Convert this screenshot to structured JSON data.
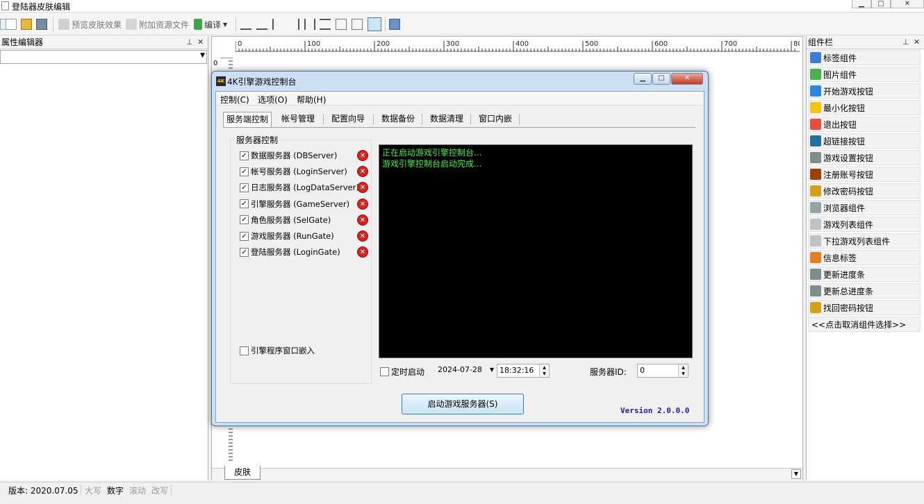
{
  "window": {
    "title": "登陆器皮肤编辑"
  },
  "toolbar": {
    "preview_label": "预览皮肤效果",
    "attach_label": "附加资源文件",
    "compile_label": "编译"
  },
  "left_panel": {
    "title": "属性编辑器"
  },
  "ruler": {
    "h_labels": [
      "0",
      "100",
      "200",
      "300",
      "400",
      "500",
      "600",
      "700",
      "80"
    ],
    "v_label": "0"
  },
  "designer": {
    "tab_label": "皮肤"
  },
  "right_panel": {
    "title": "组件栏",
    "items": [
      {
        "label": "标签组件",
        "color": "#3a7fd5"
      },
      {
        "label": "图片组件",
        "color": "#4caf50"
      },
      {
        "label": "开始游戏按钮",
        "color": "#2e86de"
      },
      {
        "label": "最小化按钮",
        "color": "#f1c40f"
      },
      {
        "label": "退出按钮",
        "color": "#e74c3c"
      },
      {
        "label": "超链接按钮",
        "color": "#2471a3"
      },
      {
        "label": "游戏设置按钮",
        "color": "#7f8c8d"
      },
      {
        "label": "注册账号按钮",
        "color": "#a04000"
      },
      {
        "label": "修改密码按钮",
        "color": "#d4a017"
      },
      {
        "label": "浏览器组件",
        "color": "#95a5a6"
      },
      {
        "label": "游戏列表组件",
        "color": "#bdc3c7"
      },
      {
        "label": "下拉游戏列表组件",
        "color": "#bdc3c7"
      },
      {
        "label": "信息标签",
        "color": "#e67e22"
      },
      {
        "label": "更新进度条",
        "color": "#7f8c8d"
      },
      {
        "label": "更新总进度条",
        "color": "#7f8c8d"
      },
      {
        "label": "找回密码按钮",
        "color": "#d4a017"
      }
    ],
    "cancel_label": "<<点击取消组件选择>>"
  },
  "statusbar": {
    "version": "版本: 2020.07.05",
    "caps": "大写",
    "num": "数字",
    "scroll": "滚动",
    "insert": "改写"
  },
  "dialog": {
    "icon_text": "4K",
    "title": "4K引擎游戏控制台",
    "menu": [
      "控制(C)",
      "选项(O)",
      "帮助(H)"
    ],
    "tabs": [
      "服务端控制",
      "帐号管理",
      "配置向导",
      "数据备份",
      "数据清理",
      "窗口内嵌"
    ],
    "group_caption": "服务器控制",
    "servers": [
      {
        "label": "数据服务器 (DBServer)",
        "checked": true
      },
      {
        "label": "帐号服务器 (LoginServer)",
        "checked": true
      },
      {
        "label": "日志服务器 (LogDataServer)",
        "checked": true
      },
      {
        "label": "引擎服务器 (GameServer)",
        "checked": true
      },
      {
        "label": "角色服务器 (SelGate)",
        "checked": true
      },
      {
        "label": "游戏服务器 (RunGate)",
        "checked": true
      },
      {
        "label": "登陆服务器 (LoginGate)",
        "checked": true
      }
    ],
    "embed_label": "引擎程序窗口嵌入",
    "console_lines": [
      "正在启动游戏引擎控制台...",
      "游戏引擎控制台启动完成..."
    ],
    "timer_label": "定时启动",
    "date_value": "2024-07-28",
    "time_value": "18:32:16",
    "server_id_label": "服务器ID:",
    "server_id_value": "0",
    "start_button": "启动游戏服务器(S)",
    "version": "Version 2.0.0.0"
  }
}
